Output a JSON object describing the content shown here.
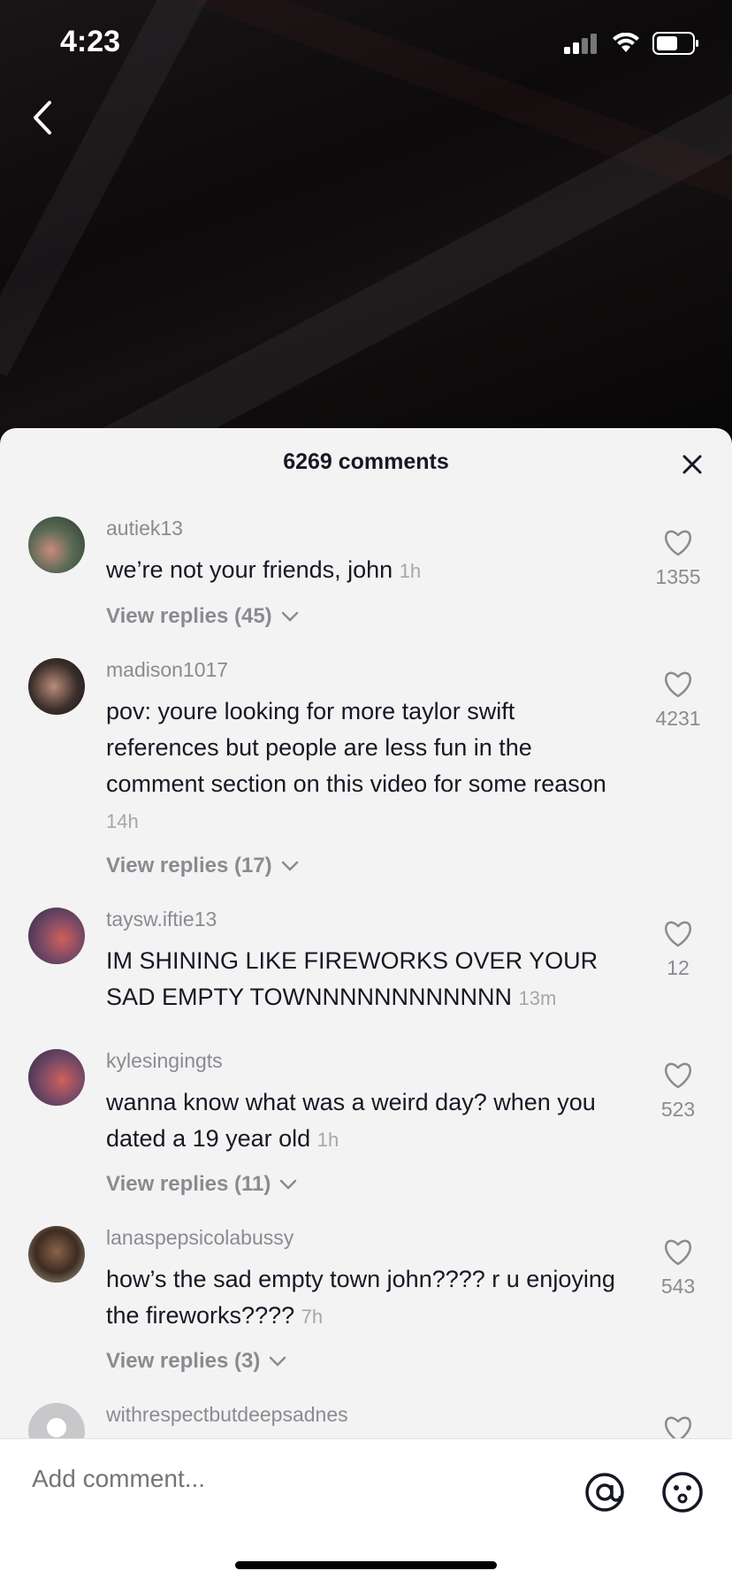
{
  "status_bar": {
    "time": "4:23"
  },
  "sheet": {
    "title": "6269 comments"
  },
  "comments": [
    {
      "username": "autiek13",
      "text": "we’re not your friends, john",
      "time": "1h",
      "likes": "1355",
      "replies": "View replies (45)"
    },
    {
      "username": "madison1017",
      "text": "pov: youre looking for more taylor swift references but people are less fun in the comment section on this video for some reason",
      "time": "14h",
      "likes": "4231",
      "replies": "View replies (17)"
    },
    {
      "username": "taysw.iftie13",
      "text": "IM SHINING LIKE FIREWORKS OVER YOUR SAD EMPTY TOWNNNNNNNNNNNN",
      "time": "13m",
      "likes": "12"
    },
    {
      "username": "kylesingingts",
      "text": "wanna know what was a weird day? when you dated a 19 year old",
      "time": "1h",
      "likes": "523",
      "replies": "View replies (11)"
    },
    {
      "username": "lanaspepsicolabussy",
      "text": "how’s the sad empty town john???? r u enjoying the fireworks????",
      "time": "7h",
      "likes": "543",
      "replies": "View replies (3)"
    },
    {
      "username": "withrespectbutdeepsadnes"
    }
  ],
  "composer": {
    "placeholder": "Add comment..."
  },
  "icons": {
    "back": "chevron-left-icon",
    "close": "close-icon",
    "like": "heart-icon",
    "at": "at-sign-icon",
    "emoji": "emoji-icon",
    "replies": "chevron-down-icon"
  }
}
